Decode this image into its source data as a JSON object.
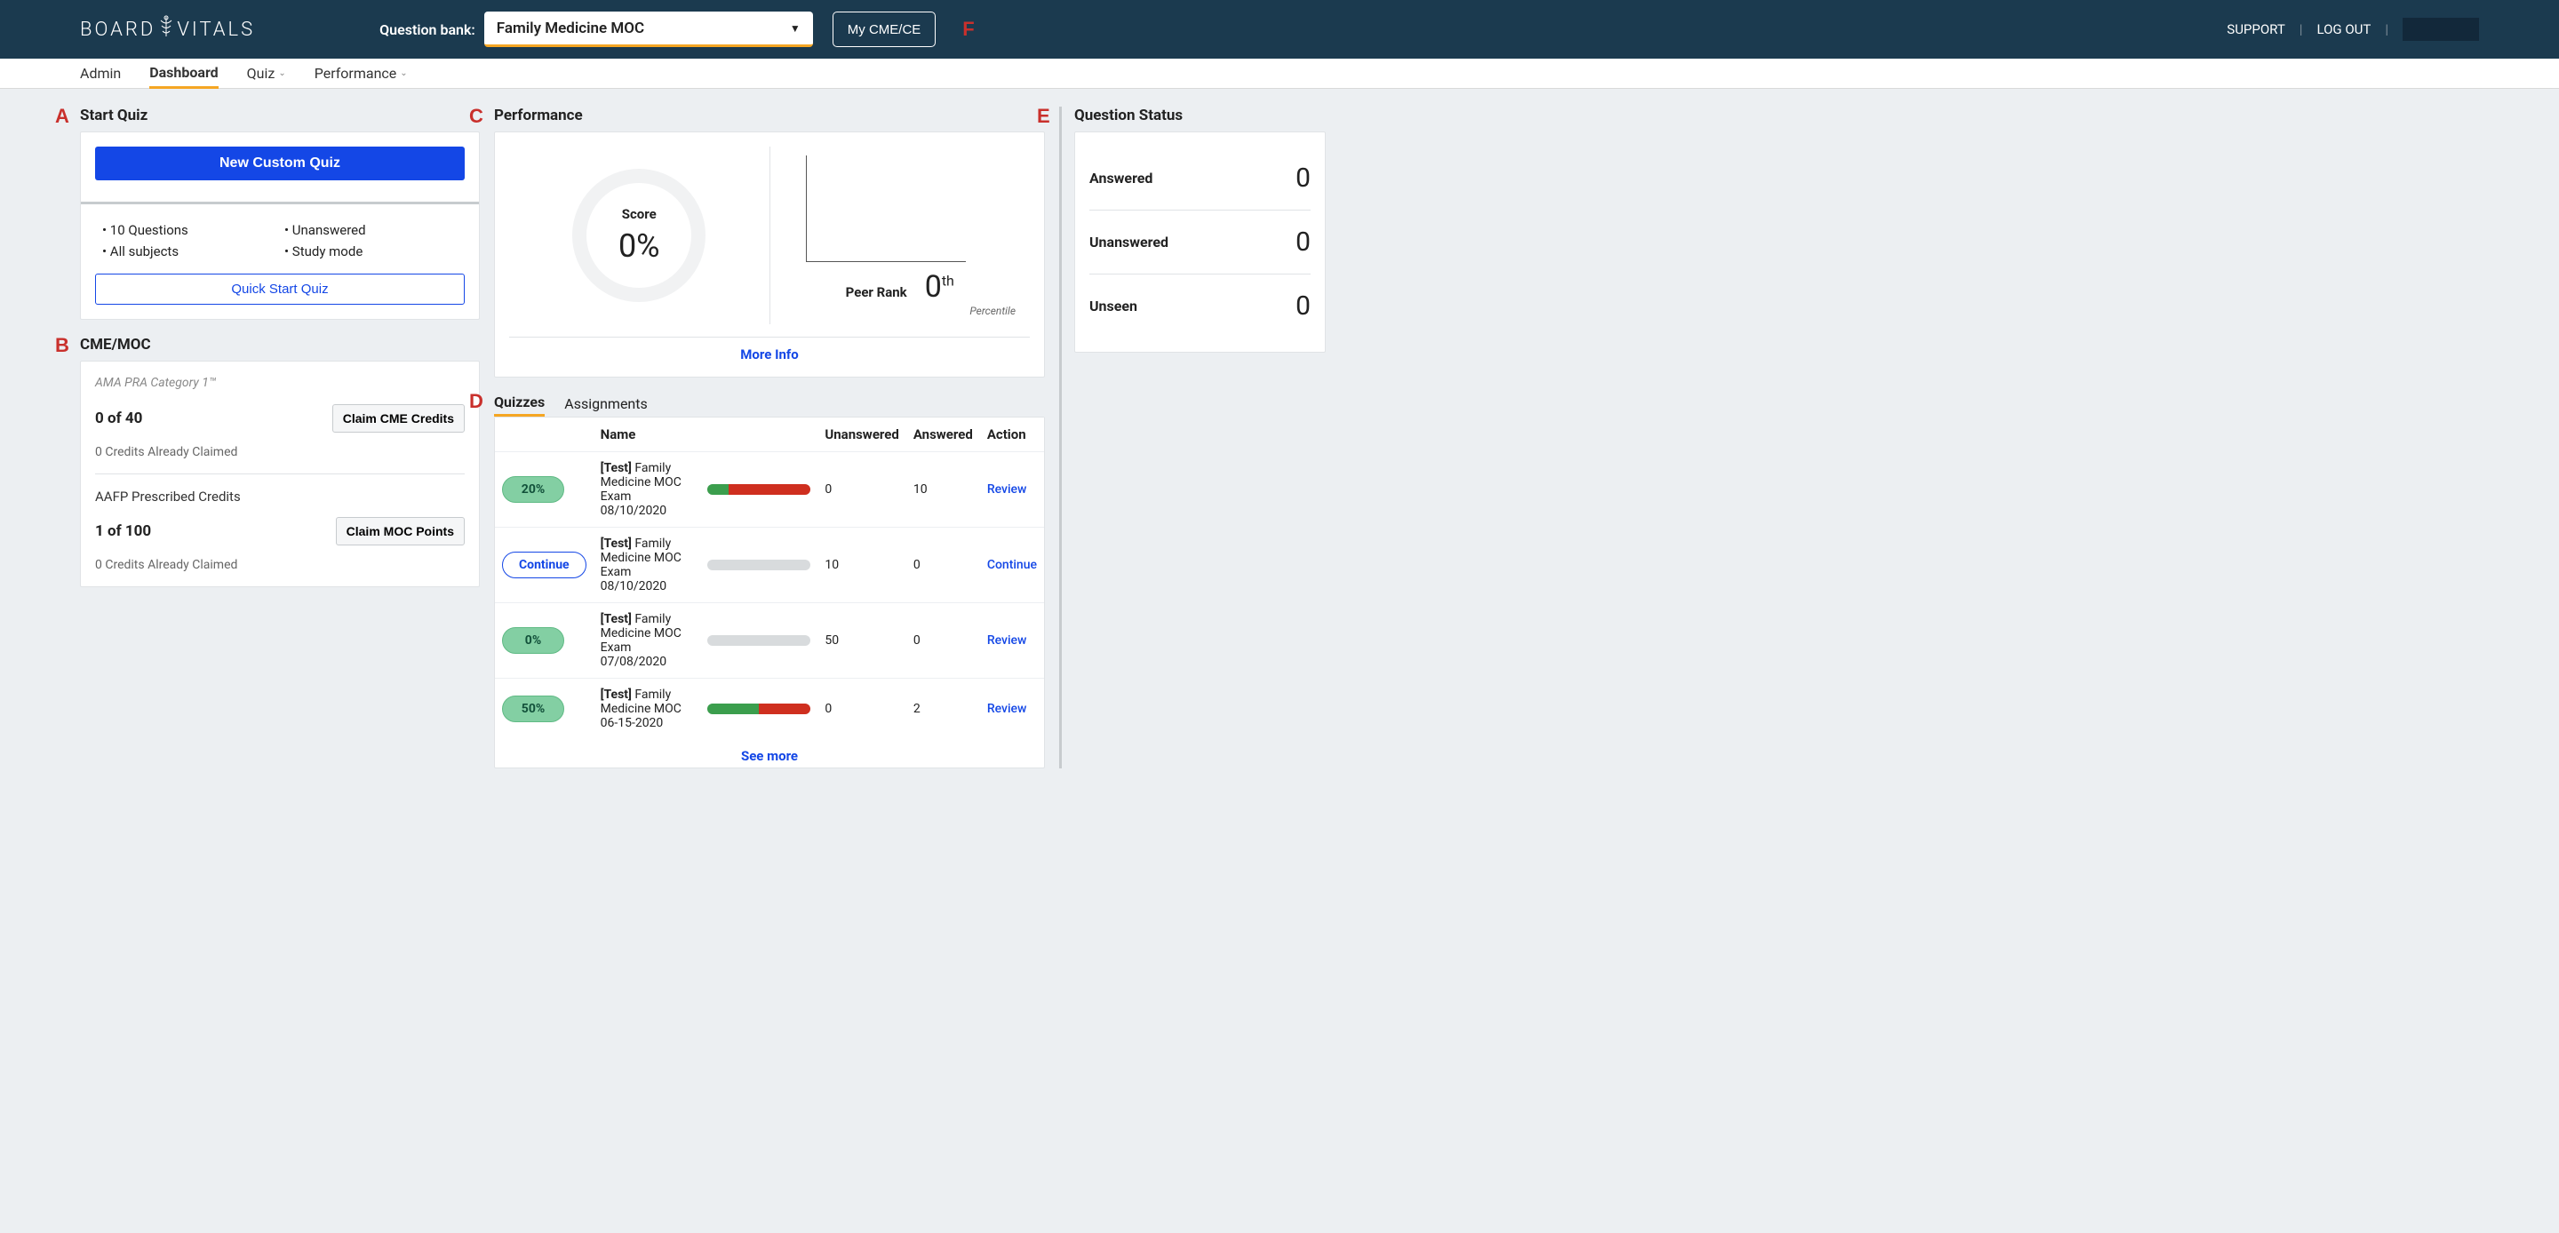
{
  "header": {
    "logo_text_a": "BOARD",
    "logo_text_b": "VITALS",
    "qbank_label": "Question bank:",
    "qbank_selected": "Family Medicine MOC",
    "mycme_label": "My CME/CE",
    "support_label": "SUPPORT",
    "logout_label": "LOG OUT"
  },
  "nav": {
    "items": [
      {
        "label": "Admin",
        "active": false,
        "caret": false
      },
      {
        "label": "Dashboard",
        "active": true,
        "caret": false
      },
      {
        "label": "Quiz",
        "active": false,
        "caret": true
      },
      {
        "label": "Performance",
        "active": false,
        "caret": true
      }
    ]
  },
  "annotations": {
    "A": "A",
    "B": "B",
    "C": "C",
    "D": "D",
    "E": "E",
    "F": "F"
  },
  "start_quiz": {
    "title": "Start Quiz",
    "new_btn": "New Custom Quiz",
    "defaults": [
      "10 Questions",
      "Unanswered",
      "All subjects",
      "Study mode"
    ],
    "quick_btn": "Quick Start Quiz"
  },
  "cme": {
    "title": "CME/MOC",
    "category": "AMA PRA Category 1™",
    "cme_count": "0 of 40",
    "claim_cme": "Claim CME Credits",
    "cme_claimed": "0 Credits Already Claimed",
    "aafp_label": "AAFP Prescribed Credits",
    "moc_count": "1 of 100",
    "claim_moc": "Claim MOC Points",
    "moc_claimed": "0 Credits Already Claimed"
  },
  "performance": {
    "title": "Performance",
    "score_label": "Score",
    "score_value": "0%",
    "rank_label": "Peer Rank",
    "rank_value": "0",
    "rank_suffix": "th",
    "rank_pct": "Percentile",
    "more": "More Info"
  },
  "quizzes": {
    "tabs": [
      {
        "label": "Quizzes",
        "active": true
      },
      {
        "label": "Assignments",
        "active": false
      }
    ],
    "headers": {
      "name": "Name",
      "unanswered": "Unanswered",
      "answered": "Answered",
      "action": "Action"
    },
    "rows": [
      {
        "badge": "20%",
        "badge_type": "green",
        "name_prefix": "[Test]",
        "name": " Family Medicine MOC Exam 08/10/2020",
        "bar_g": 20,
        "bar_r": 80,
        "unanswered": "0",
        "answered": "10",
        "action": "Review"
      },
      {
        "badge": "Continue",
        "badge_type": "outline",
        "name_prefix": "[Test]",
        "name": " Family Medicine MOC Exam 08/10/2020",
        "bar_g": 0,
        "bar_r": 0,
        "unanswered": "10",
        "answered": "0",
        "action": "Continue"
      },
      {
        "badge": "0%",
        "badge_type": "green",
        "name_prefix": "[Test]",
        "name": " Family Medicine MOC Exam 07/08/2020",
        "bar_g": 0,
        "bar_r": 0,
        "unanswered": "50",
        "answered": "0",
        "action": "Review"
      },
      {
        "badge": "50%",
        "badge_type": "green",
        "name_prefix": "[Test]",
        "name": " Family Medicine MOC 06-15-2020",
        "bar_g": 50,
        "bar_r": 50,
        "unanswered": "0",
        "answered": "2",
        "action": "Review"
      }
    ],
    "see_more": "See more"
  },
  "status": {
    "title": "Question Status",
    "rows": [
      {
        "label": "Answered",
        "value": "0"
      },
      {
        "label": "Unanswered",
        "value": "0"
      },
      {
        "label": "Unseen",
        "value": "0"
      }
    ]
  }
}
